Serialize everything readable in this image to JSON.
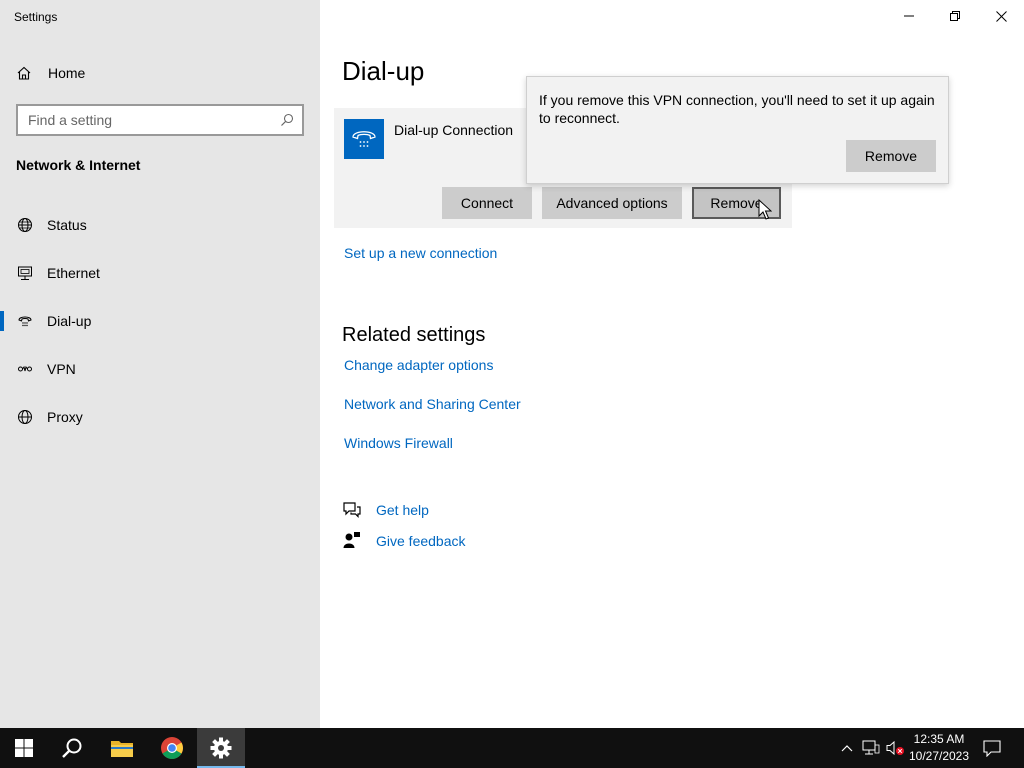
{
  "window": {
    "title": "Settings"
  },
  "sidebar": {
    "home_label": "Home",
    "search_placeholder": "Find a setting",
    "section_title": "Network & Internet",
    "items": [
      {
        "label": "Status",
        "icon": "globe-icon"
      },
      {
        "label": "Ethernet",
        "icon": "ethernet-icon"
      },
      {
        "label": "Dial-up",
        "icon": "dialup-icon",
        "active": true
      },
      {
        "label": "VPN",
        "icon": "vpn-icon"
      },
      {
        "label": "Proxy",
        "icon": "globe-icon"
      }
    ]
  },
  "main": {
    "page_title": "Dial-up",
    "connection": {
      "name": "Dial-up Connection",
      "icon": "telephone-icon",
      "buttons": {
        "connect": "Connect",
        "advanced": "Advanced options",
        "remove": "Remove"
      }
    },
    "setup_link": "Set up a new connection",
    "related_title": "Related settings",
    "related_links": [
      "Change adapter options",
      "Network and Sharing Center",
      "Windows Firewall"
    ],
    "help": {
      "get_help": "Get help",
      "give_feedback": "Give feedback"
    }
  },
  "flyout": {
    "message": "If you remove this VPN connection, you'll need to set it up again to reconnect.",
    "remove_label": "Remove"
  },
  "taskbar": {
    "time": "12:35 AM",
    "date": "10/27/2023",
    "apps": [
      "start-icon",
      "search-icon",
      "file-explorer-icon",
      "chrome-icon",
      "settings-icon"
    ]
  },
  "colors": {
    "accent": "#0067c0",
    "sidebar_bg": "#e6e6e6",
    "taskbar_bg": "#101010"
  }
}
